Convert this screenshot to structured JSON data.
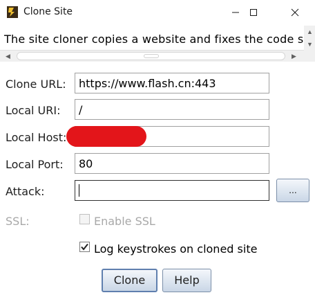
{
  "window": {
    "title": "Clone Site",
    "minimize_icon": "minimize-icon",
    "maximize_icon": "maximize-icon",
    "close_icon": "close-icon"
  },
  "description": {
    "text": "The site cloner copies a website and fixes the code so"
  },
  "form": {
    "clone_url": {
      "label": "Clone URL:",
      "value": "https://www.flash.cn:443"
    },
    "local_uri": {
      "label": "Local URI:",
      "value": "/"
    },
    "local_host": {
      "label": "Local Host:",
      "value": ""
    },
    "local_port": {
      "label": "Local Port:",
      "value": "80"
    },
    "attack": {
      "label": "Attack:",
      "value": "",
      "browse_label": "..."
    },
    "ssl": {
      "label": "SSL:",
      "checkbox_label": "Enable SSL",
      "checked": false,
      "enabled": false
    },
    "log_keystrokes": {
      "label": "Log keystrokes on cloned site",
      "checked": true
    }
  },
  "buttons": {
    "clone": "Clone",
    "help": "Help"
  },
  "colors": {
    "redaction": "#e3151a",
    "button_border": "#7a8ea8"
  }
}
